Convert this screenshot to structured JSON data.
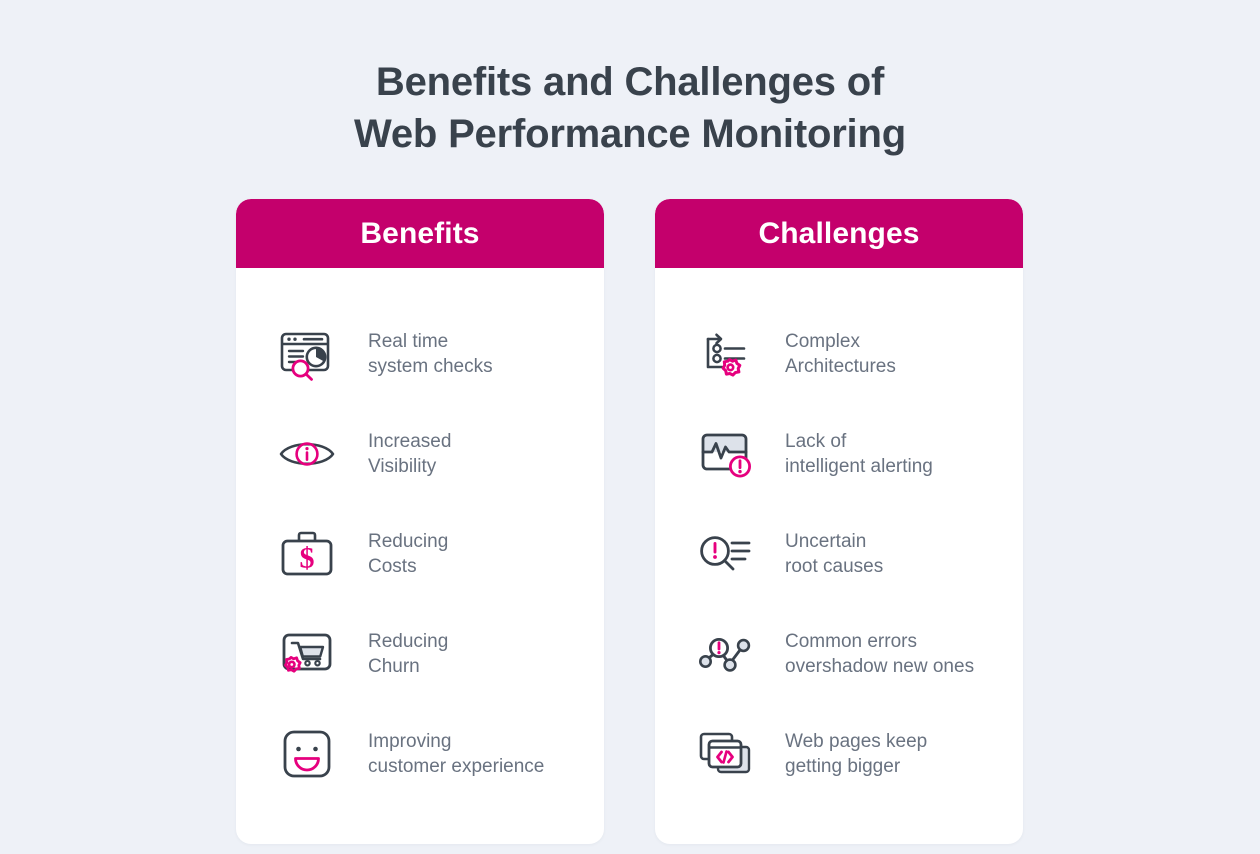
{
  "title": {
    "line1": "Benefits and Challenges of",
    "line2": "Web Performance Monitoring"
  },
  "colors": {
    "background": "#eef1f7",
    "card_background": "#ffffff",
    "header_pink": "#c4006c",
    "accent_pink": "#e6007e",
    "title_text": "#39424c",
    "item_text": "#697280",
    "icon_dark": "#39424c",
    "icon_fill": "#dde2ea"
  },
  "cards": [
    {
      "id": "benefits",
      "header": "Benefits",
      "items": [
        {
          "icon": "realtime-system-checks-icon",
          "line1": "Real time",
          "line2": "system checks"
        },
        {
          "icon": "increased-visibility-icon",
          "line1": "Increased",
          "line2": "Visibility"
        },
        {
          "icon": "reducing-costs-icon",
          "line1": "Reducing",
          "line2": "Costs"
        },
        {
          "icon": "reducing-churn-icon",
          "line1": "Reducing",
          "line2": "Churn"
        },
        {
          "icon": "improving-customer-experience-icon",
          "line1": "Improving",
          "line2": "customer experience"
        }
      ]
    },
    {
      "id": "challenges",
      "header": "Challenges",
      "items": [
        {
          "icon": "complex-architectures-icon",
          "line1": "Complex",
          "line2": "Architectures"
        },
        {
          "icon": "lack-of-intelligent-alerting-icon",
          "line1": "Lack of",
          "line2": "intelligent alerting"
        },
        {
          "icon": "uncertain-root-causes-icon",
          "line1": "Uncertain",
          "line2": "root causes"
        },
        {
          "icon": "common-errors-overshadow-icon",
          "line1": "Common errors",
          "line2": "overshadow new ones"
        },
        {
          "icon": "web-pages-getting-bigger-icon",
          "line1": "Web pages keep",
          "line2": "getting bigger"
        }
      ]
    }
  ]
}
